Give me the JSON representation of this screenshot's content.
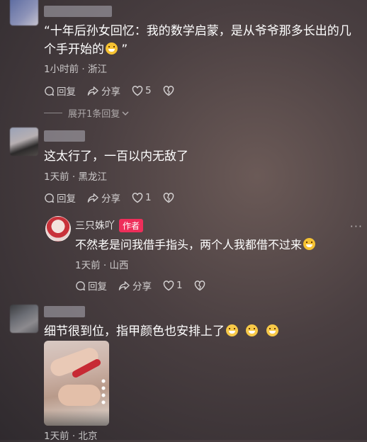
{
  "comments": [
    {
      "text": "“十年后孙女回忆：我的数学启蒙，是从爷爷那多长出的几个手开始的",
      "text_close": "”",
      "time": "1小时前",
      "location": "浙江",
      "reply_label": "回复",
      "share_label": "分享",
      "likes": "5",
      "expand_label": "展开1条回复"
    },
    {
      "text": "这太行了，一百以内无敌了",
      "time": "1天前",
      "location": "黑龙江",
      "reply_label": "回复",
      "share_label": "分享",
      "likes": "1"
    },
    {
      "text": "细节很到位，指甲颜色也安排上了",
      "time": "1天前",
      "location": "北京"
    }
  ],
  "reply": {
    "name": "三只姝吖",
    "author_tag": "作者",
    "text": "不然老是问我借手指头，两个人我都借不过来",
    "time": "1天前",
    "location": "山西",
    "reply_label": "回复",
    "share_label": "分享",
    "likes": "1",
    "more_icon": "ellipsis-icon"
  },
  "separator": "·",
  "colors": {
    "author_tag": "#ee2e5a",
    "background": "#4a3f41"
  }
}
